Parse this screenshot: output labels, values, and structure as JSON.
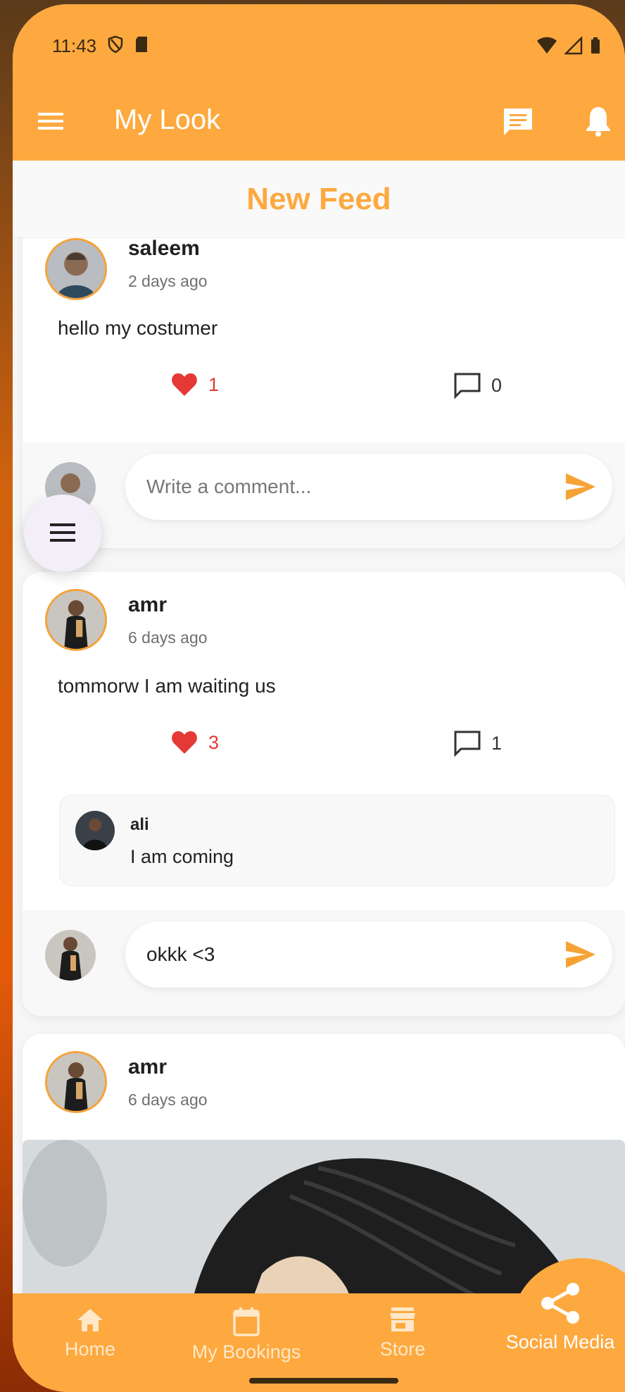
{
  "status_bar": {
    "time": "11:43"
  },
  "app_bar": {
    "title": "My Look"
  },
  "tab": {
    "title": "New Feed"
  },
  "posts": [
    {
      "author": "saleem",
      "time": "2 days ago",
      "text": "hello my costumer",
      "likes": "1",
      "comments": "0",
      "comment_placeholder": "Write a comment..."
    },
    {
      "author": "amr",
      "time": "6 days ago",
      "text": "tommorw I am waiting us",
      "likes": "3",
      "comments": "1",
      "reply": {
        "author": "ali",
        "text": "I am coming"
      },
      "comment_value": "okkk <3"
    },
    {
      "author": "amr",
      "time": "6 days ago"
    }
  ],
  "bottom_nav": {
    "items": [
      {
        "label": "Home",
        "icon": "home-icon"
      },
      {
        "label": "My Bookings",
        "icon": "calendar-icon"
      },
      {
        "label": "Store",
        "icon": "store-icon"
      },
      {
        "label": "Social Media",
        "icon": "share-icon"
      }
    ],
    "active": "Social Media"
  },
  "colors": {
    "primary": "#fda93f",
    "like": "#e53935",
    "send": "#f6a235"
  }
}
